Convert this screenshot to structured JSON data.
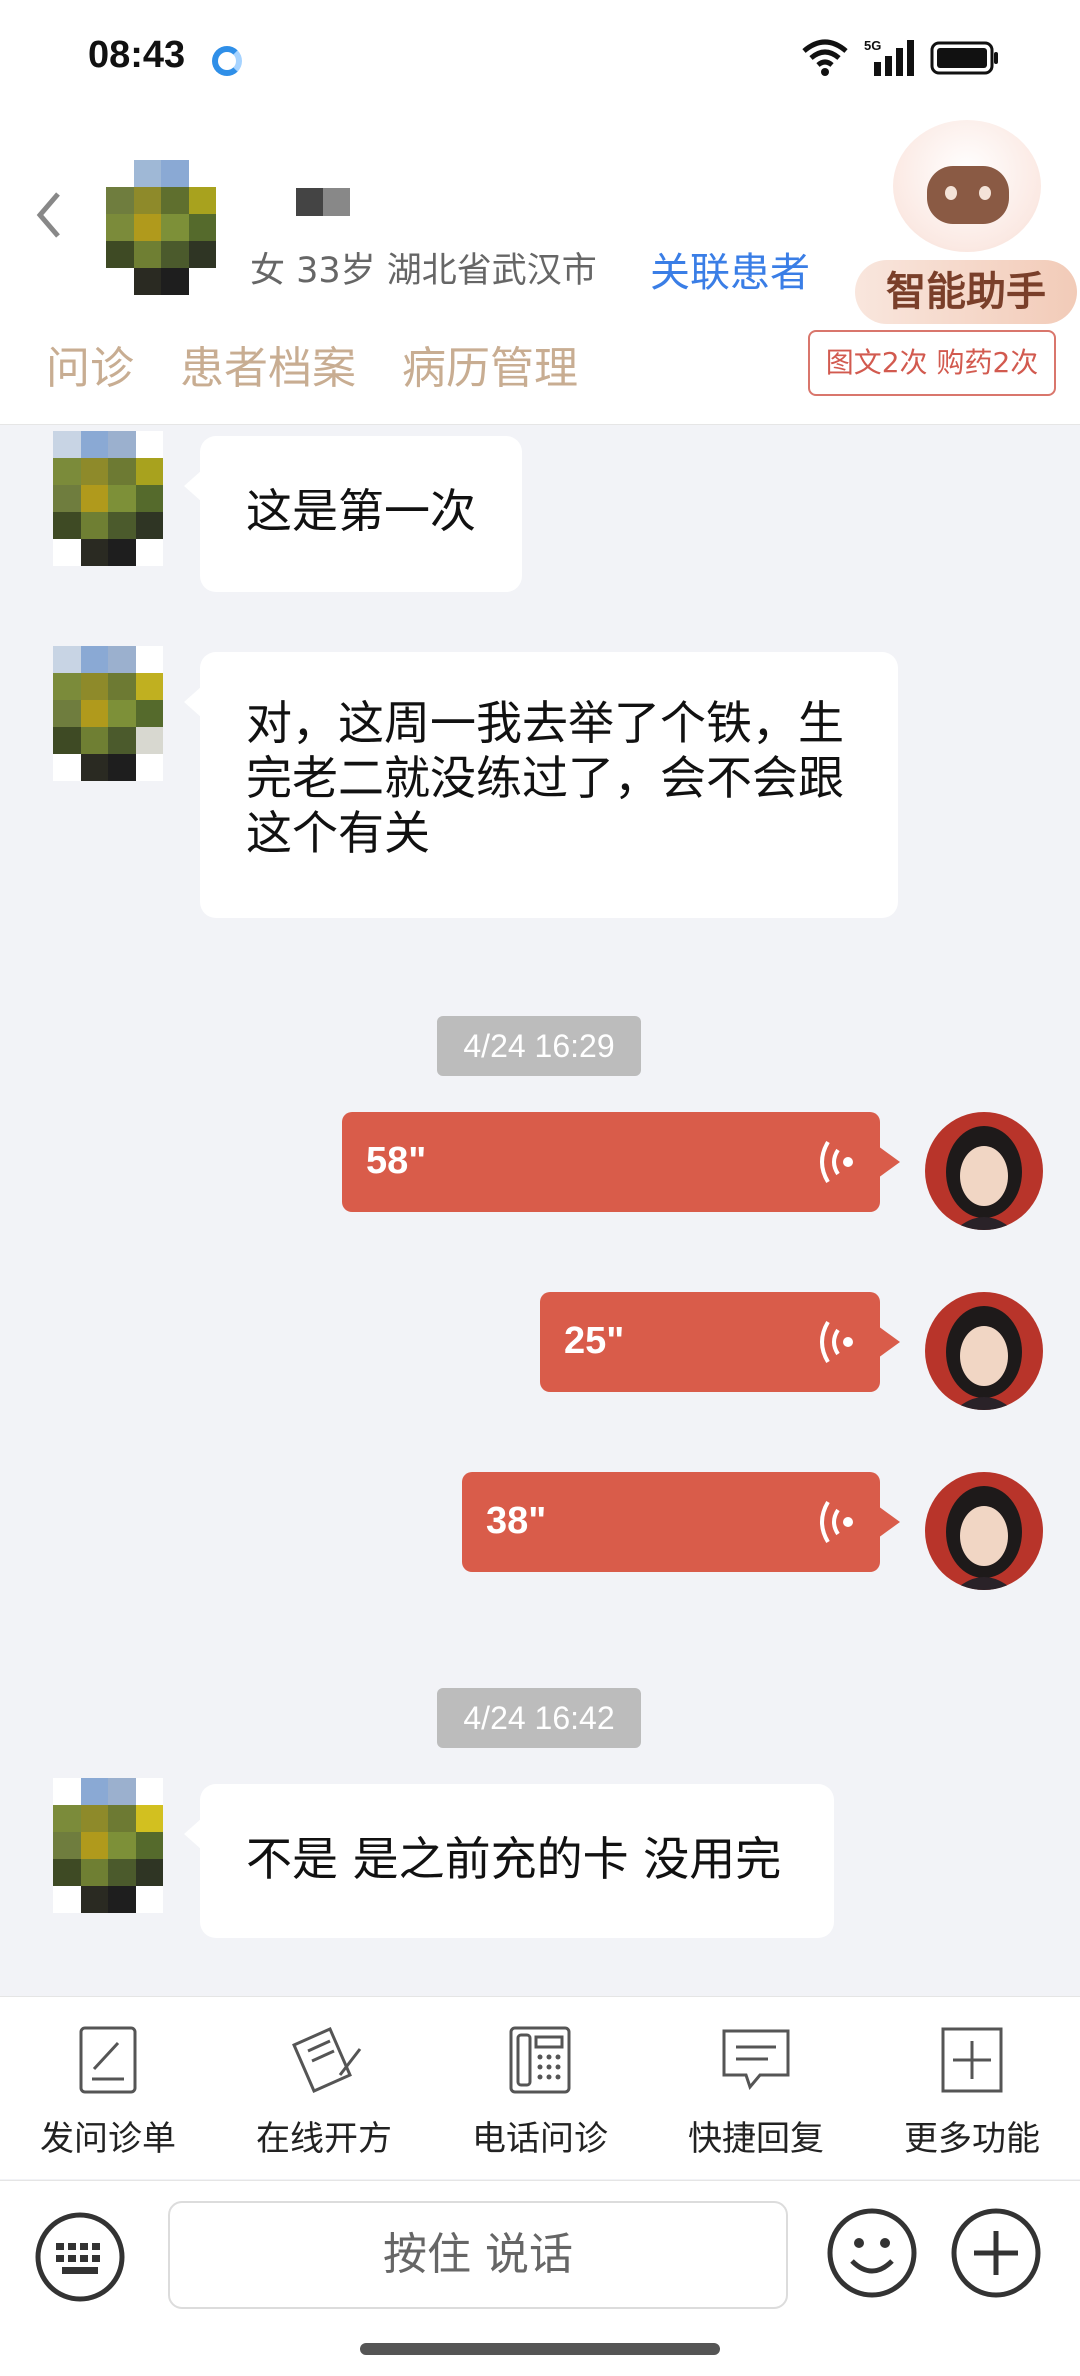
{
  "status": {
    "time": "08:43",
    "network": "5G"
  },
  "header": {
    "patient_info": "女 33岁  湖北省武汉市",
    "link_patient": "关联患者",
    "assistant_label": "智能助手",
    "tabs": [
      "问诊",
      "患者档案",
      "病历管理"
    ],
    "count_badge": "图文2次 购药2次"
  },
  "messages": [
    {
      "type": "text",
      "from": "patient",
      "text": "这是第一次"
    },
    {
      "type": "text",
      "from": "patient",
      "lines": [
        "对，这周一我去举了个铁，生",
        "完老二就没练过了，会不会跟",
        "这个有关"
      ]
    },
    {
      "type": "time",
      "text": "4/24 16:29"
    },
    {
      "type": "voice",
      "from": "doctor",
      "duration": "58\""
    },
    {
      "type": "voice",
      "from": "doctor",
      "duration": "25\""
    },
    {
      "type": "voice",
      "from": "doctor",
      "duration": "38\""
    },
    {
      "type": "time",
      "text": "4/24 16:42"
    },
    {
      "type": "text",
      "from": "patient",
      "text": "不是 是之前充的卡 没用完"
    }
  ],
  "toolbar": [
    "发问诊单",
    "在线开方",
    "电话问诊",
    "快捷回复",
    "更多功能"
  ],
  "input": {
    "voice_label": "按住 说话"
  },
  "colors": {
    "voice_bubble": "#d95c4a",
    "link": "#3a7ee6",
    "tab_text": "#c8ad92",
    "badge": "#d25a4f"
  }
}
